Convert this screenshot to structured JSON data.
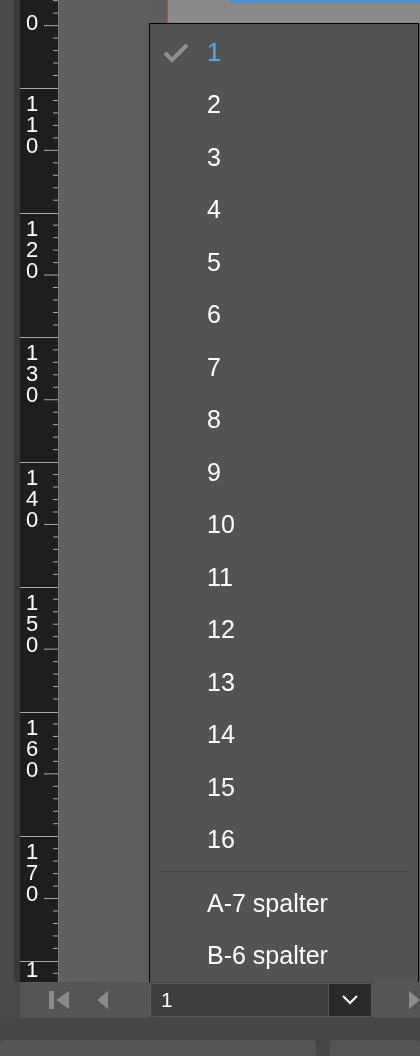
{
  "ruler": {
    "labels": [
      "0",
      "110",
      "120",
      "130",
      "140",
      "150",
      "160",
      "170",
      "1"
    ]
  },
  "dropdown_menu": {
    "items": [
      {
        "label": "1",
        "selected": true
      },
      {
        "label": "2",
        "selected": false
      },
      {
        "label": "3",
        "selected": false
      },
      {
        "label": "4",
        "selected": false
      },
      {
        "label": "5",
        "selected": false
      },
      {
        "label": "6",
        "selected": false
      },
      {
        "label": "7",
        "selected": false
      },
      {
        "label": "8",
        "selected": false
      },
      {
        "label": "9",
        "selected": false
      },
      {
        "label": "10",
        "selected": false
      },
      {
        "label": "11",
        "selected": false
      },
      {
        "label": "12",
        "selected": false
      },
      {
        "label": "13",
        "selected": false
      },
      {
        "label": "14",
        "selected": false
      },
      {
        "label": "15",
        "selected": false
      },
      {
        "label": "16",
        "selected": false
      }
    ],
    "masters": [
      {
        "label": "A-7 spalter",
        "selected": false
      },
      {
        "label": "B-6 spalter",
        "selected": false
      }
    ]
  },
  "page_navigation": {
    "page_field": {
      "value": "1"
    }
  }
}
